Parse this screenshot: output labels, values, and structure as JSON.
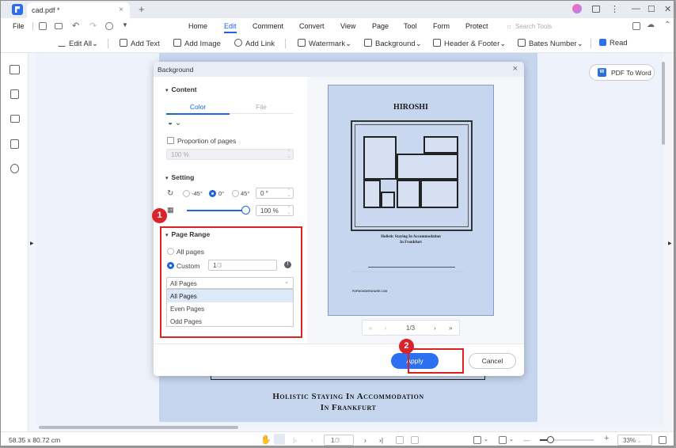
{
  "window": {
    "tab_title": "cad.pdf *",
    "tab_close": "×",
    "new_tab": "+",
    "controls": {
      "more": "⋮",
      "minimize": "—",
      "maximize": "☐",
      "close": "✕"
    }
  },
  "menubar": {
    "file": "File",
    "items": [
      "Home",
      "Edit",
      "Comment",
      "Convert",
      "View",
      "Page",
      "Tool",
      "Form",
      "Protect"
    ],
    "active": "Edit",
    "search_placeholder": "Search Tools"
  },
  "toolbar": {
    "edit_all": "Edit All",
    "add_text": "Add Text",
    "add_image": "Add Image",
    "add_link": "Add Link",
    "watermark": "Watermark",
    "background": "Background",
    "header_footer": "Header & Footer",
    "bates_number": "Bates Number",
    "read": "Read",
    "read_checked": true
  },
  "side_button": {
    "pdf_to_word": "PDF To Word",
    "word_glyph": "W"
  },
  "document": {
    "heading_line1": "Holistic Staying In Accommodation",
    "heading_line2": "In Frankfurt"
  },
  "dialog": {
    "title": "Background",
    "close": "×",
    "content_section": "Content",
    "tabs": [
      "Color",
      "File"
    ],
    "active_tab": "Color",
    "proportion_label": "Proportion of pages",
    "proportion_checked": false,
    "proportion_value": "100 %",
    "setting_section": "Setting",
    "rotation_options": [
      "-45°",
      "0°",
      "45°"
    ],
    "rotation_selected": "0°",
    "rotation_value": "0 °",
    "opacity_value": "100 %",
    "opacity_percent": 100,
    "page_range_section": "Page Range",
    "range_all": "All pages",
    "range_custom": "Custom",
    "range_selected": "Custom",
    "custom_value": "1",
    "custom_total": "/3",
    "info_glyph": "!",
    "subset_selected": "All Pages",
    "subset_options": [
      "All Pages",
      "Even Pages",
      "Odd Pages"
    ],
    "preview": {
      "title": "HIROSHI",
      "subtitle_line1": "Holistic Staying In Accommodation",
      "subtitle_line2": "In Frankfurt",
      "footer_text": "PDFWONDERSHARE.COM",
      "page_indicator": "1/3"
    },
    "apply": "Apply",
    "cancel": "Cancel"
  },
  "annotations": {
    "badge1": "1",
    "badge2": "2",
    "color": "#d8232a"
  },
  "statusbar": {
    "dimensions": "58.35 x 80.72 cm",
    "page_current": "1",
    "page_total": "/3",
    "zoom": "33%",
    "zoom_fraction": 0.33
  },
  "colors": {
    "accent": "#2c6ff0",
    "page_background": "#c6d6ee"
  }
}
